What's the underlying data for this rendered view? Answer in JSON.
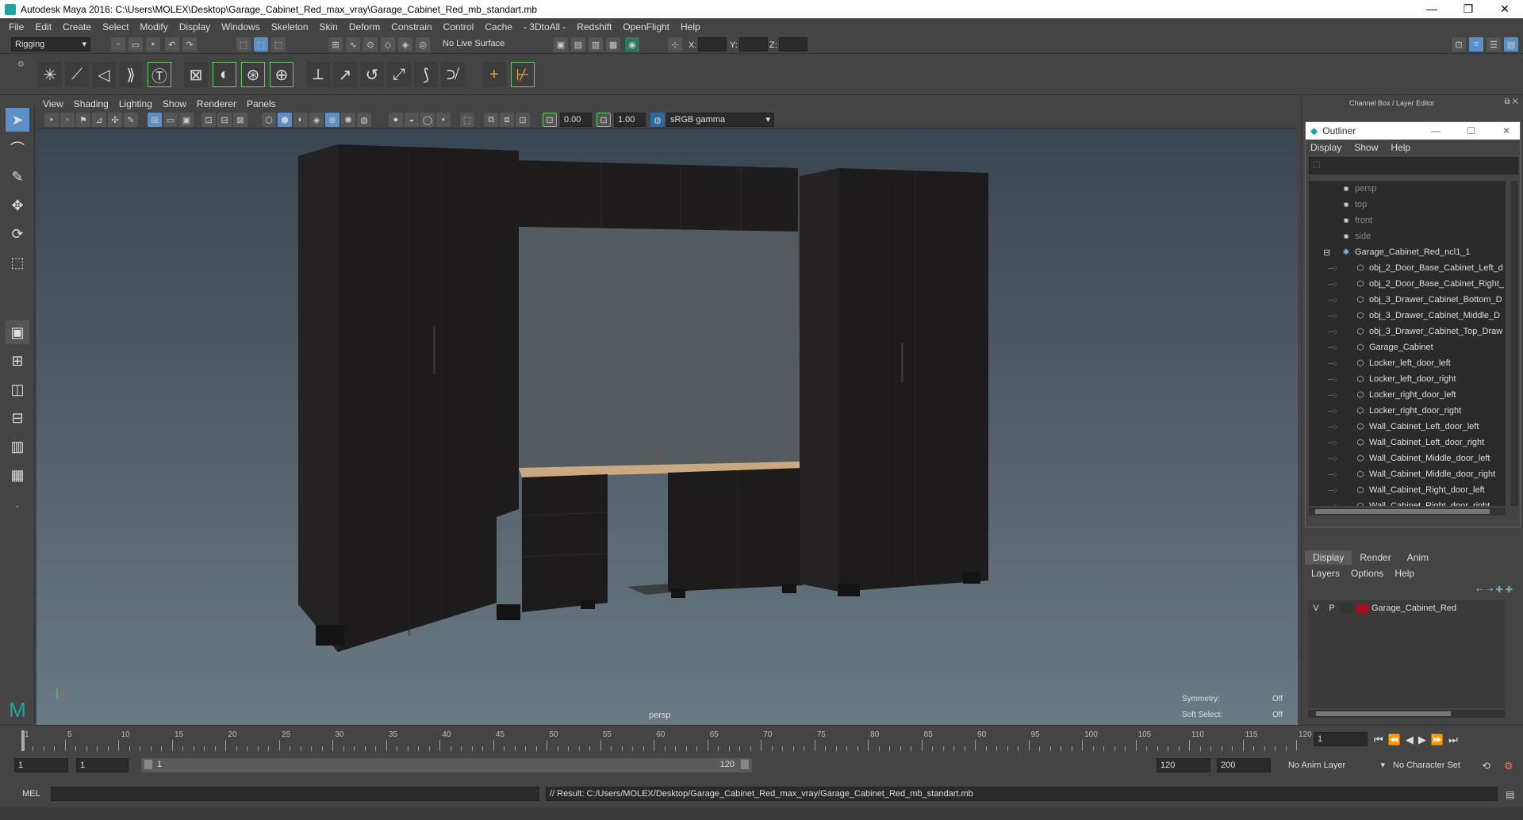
{
  "window": {
    "title": "Autodesk Maya 2016: C:\\Users\\MOLEX\\Desktop\\Garage_Cabinet_Red_max_vray\\Garage_Cabinet_Red_mb_standart.mb",
    "minimize": "—",
    "maximize": "❐",
    "close": "✕"
  },
  "menubar": [
    "File",
    "Edit",
    "Create",
    "Select",
    "Modify",
    "Display",
    "Windows",
    "Skeleton",
    "Skin",
    "Deform",
    "Constrain",
    "Control",
    "Cache",
    "- 3DtoAll -",
    "Redshift",
    "OpenFlight",
    "Help"
  ],
  "statusline": {
    "mode": "Rigging",
    "live_surface": "No Live Surface",
    "x_label": "X:",
    "y_label": "Y:",
    "z_label": "Z:"
  },
  "viewport": {
    "menus": [
      "View",
      "Shading",
      "Lighting",
      "Show",
      "Renderer",
      "Panels"
    ],
    "exposure": "0.00",
    "gamma": "1.00",
    "colorspace": "sRGB gamma",
    "camera_label": "persp",
    "symmetry_label": "Symmetry:",
    "symmetry_value": "Off",
    "soft_select_label": "Soft Select:",
    "soft_select_value": "Off"
  },
  "channel_box": {
    "title": "Channel Box / Layer Editor"
  },
  "outliner": {
    "title": "Outliner",
    "menus": [
      "Display",
      "Show",
      "Help"
    ],
    "items": [
      {
        "label": "persp",
        "type": "camera",
        "dim": true,
        "indent": 1
      },
      {
        "label": "top",
        "type": "camera",
        "dim": true,
        "indent": 1
      },
      {
        "label": "front",
        "type": "camera",
        "dim": true,
        "indent": 1
      },
      {
        "label": "side",
        "type": "camera",
        "dim": true,
        "indent": 1
      },
      {
        "label": "Garage_Cabinet_Red_ncl1_1",
        "type": "group",
        "dim": false,
        "indent": 0
      },
      {
        "label": "obj_2_Door_Base_Cabinet_Left_d",
        "type": "mesh",
        "dim": false,
        "indent": 2
      },
      {
        "label": "obj_2_Door_Base_Cabinet_Right_",
        "type": "mesh",
        "dim": false,
        "indent": 2
      },
      {
        "label": "obj_3_Drawer_Cabinet_Bottom_D",
        "type": "mesh",
        "dim": false,
        "indent": 2
      },
      {
        "label": "obj_3_Drawer_Cabinet_Middle_D",
        "type": "mesh",
        "dim": false,
        "indent": 2
      },
      {
        "label": "obj_3_Drawer_Cabinet_Top_Draw",
        "type": "mesh",
        "dim": false,
        "indent": 2
      },
      {
        "label": "Garage_Cabinet",
        "type": "mesh",
        "dim": false,
        "indent": 2
      },
      {
        "label": "Locker_left_door_left",
        "type": "mesh",
        "dim": false,
        "indent": 2
      },
      {
        "label": "Locker_left_door_right",
        "type": "mesh",
        "dim": false,
        "indent": 2
      },
      {
        "label": "Locker_right_door_left",
        "type": "mesh",
        "dim": false,
        "indent": 2
      },
      {
        "label": "Locker_right_door_right",
        "type": "mesh",
        "dim": false,
        "indent": 2
      },
      {
        "label": "Wall_Cabinet_Left_door_left",
        "type": "mesh",
        "dim": false,
        "indent": 2
      },
      {
        "label": "Wall_Cabinet_Left_door_right",
        "type": "mesh",
        "dim": false,
        "indent": 2
      },
      {
        "label": "Wall_Cabinet_Middle_door_left",
        "type": "mesh",
        "dim": false,
        "indent": 2
      },
      {
        "label": "Wall_Cabinet_Middle_door_right",
        "type": "mesh",
        "dim": false,
        "indent": 2
      },
      {
        "label": "Wall_Cabinet_Right_door_left",
        "type": "mesh",
        "dim": false,
        "indent": 2
      },
      {
        "label": "Wall_Cabinet_Right_door_right",
        "type": "mesh",
        "dim": false,
        "indent": 2
      }
    ]
  },
  "layer_editor": {
    "tabs": [
      "Display",
      "Render",
      "Anim"
    ],
    "menus": [
      "Layers",
      "Options",
      "Help"
    ],
    "layer": {
      "v": "V",
      "p": "P",
      "name": "Garage_Cabinet_Red",
      "color": "#a01020"
    }
  },
  "timeline": {
    "ticks": [
      1,
      5,
      10,
      15,
      20,
      25,
      30,
      35,
      40,
      45,
      50,
      55,
      60,
      65,
      70,
      75,
      80,
      85,
      90,
      95,
      100,
      105,
      110,
      115,
      120
    ],
    "current_frame": "1"
  },
  "range": {
    "start": "1",
    "playback_start": "1",
    "range_start_label": "1",
    "range_end_label": "120",
    "playback_end": "120",
    "end": "200",
    "anim_layer": "No Anim Layer",
    "char_set": "No Character Set"
  },
  "command": {
    "lang": "MEL",
    "result": "// Result: C:/Users/MOLEX/Desktop/Garage_Cabinet_Red_max_vray/Garage_Cabinet_Red_mb_standart.mb"
  },
  "colors": {
    "accent": "#5b8fc7",
    "layer_red": "#a01020",
    "cabinet": "#1c1a1a",
    "counter": "#c9a882"
  }
}
